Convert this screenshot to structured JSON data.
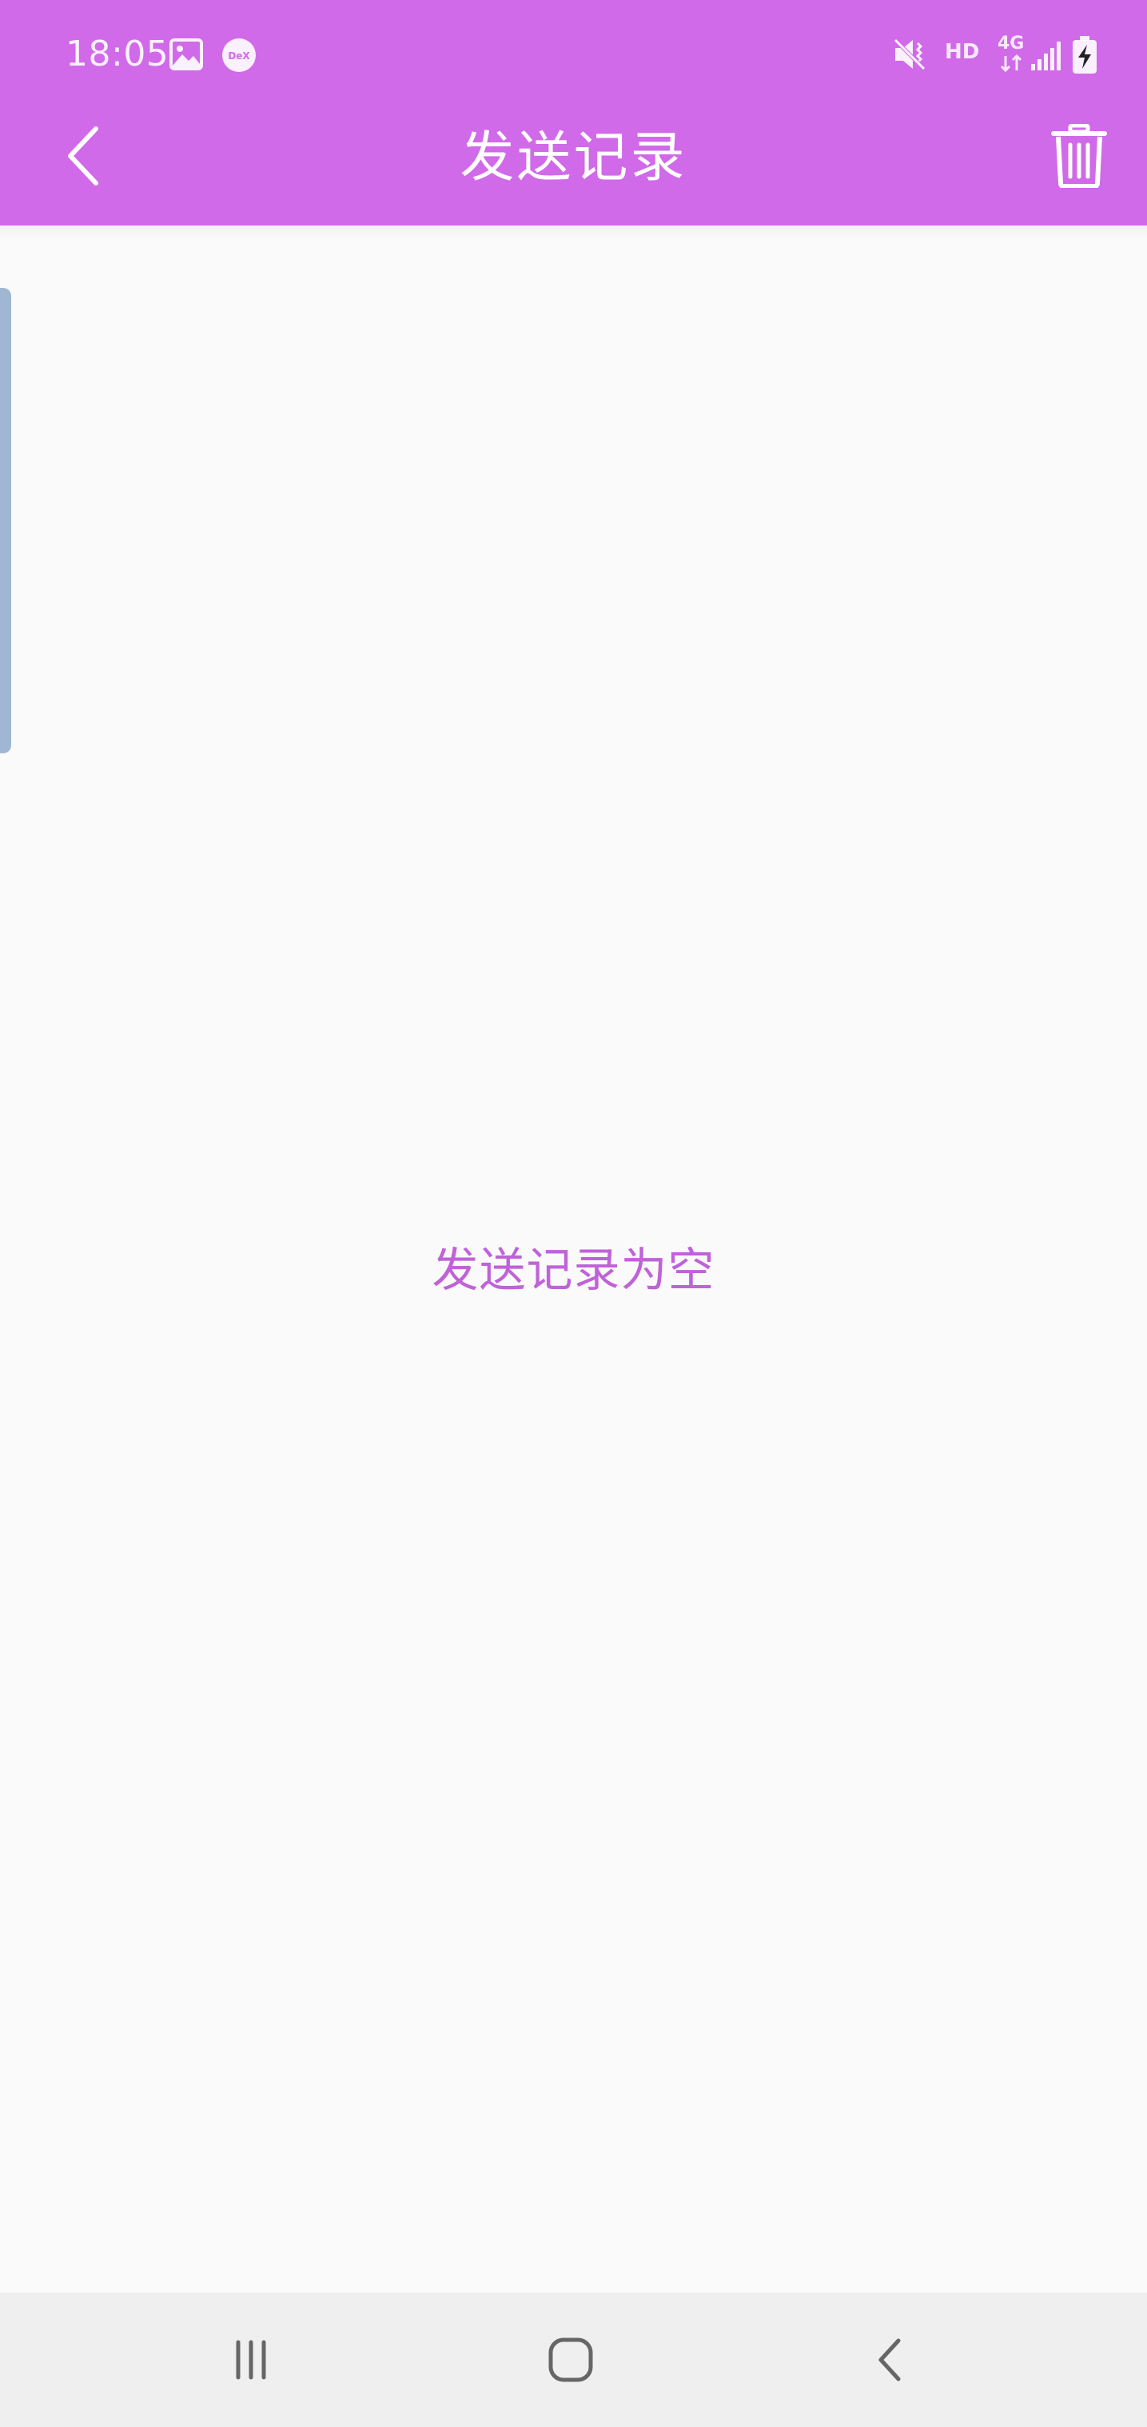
{
  "status_bar": {
    "time": "18:05",
    "icons": [
      "image-icon",
      "dex-icon",
      "mute-vibrate-icon",
      "hd-icon",
      "4g-data-icon",
      "signal-icon",
      "battery-charging-icon"
    ],
    "dex_label": "DeX",
    "hd_label": "HD",
    "network_label": "4G"
  },
  "app_bar": {
    "title": "发送记录",
    "back_icon": "chevron-left-icon",
    "delete_icon": "trash-icon",
    "background_color": "#d06ae9"
  },
  "main": {
    "empty_message": "发送记录为空",
    "empty_message_color": "#c062d8"
  },
  "nav_bar": {
    "buttons": [
      "recents-button",
      "home-button",
      "back-button"
    ]
  }
}
